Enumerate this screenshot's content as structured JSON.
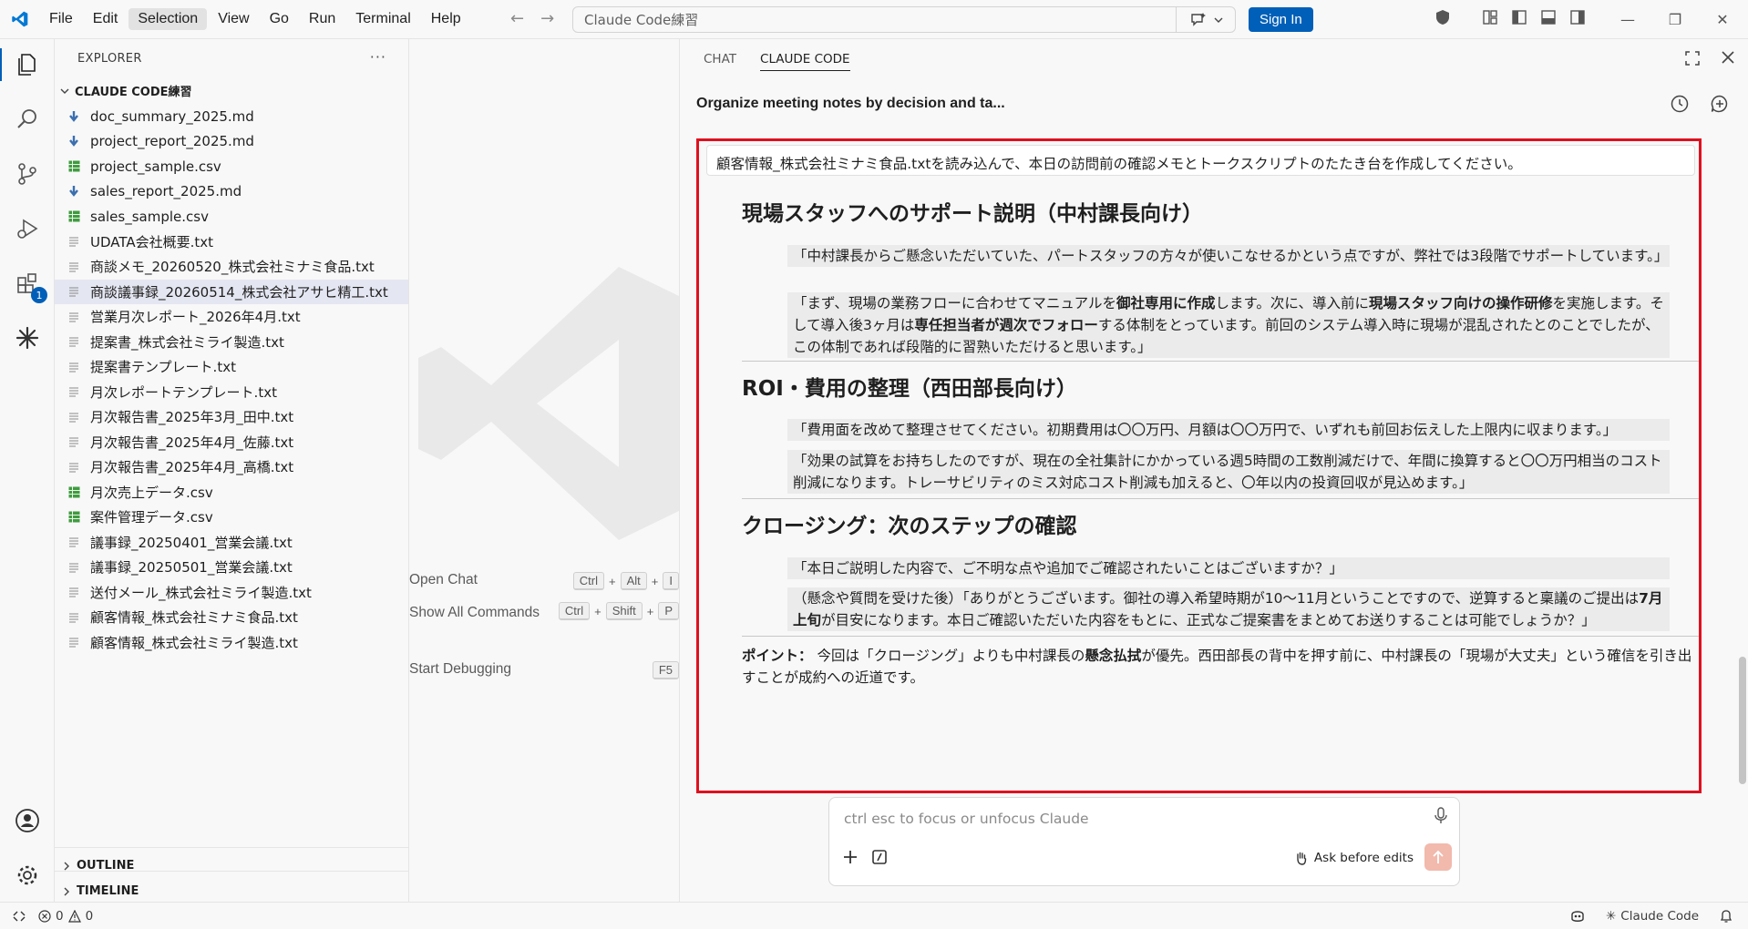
{
  "menu": [
    "File",
    "Edit",
    "Selection",
    "View",
    "Go",
    "Run",
    "Terminal",
    "Help"
  ],
  "search": {
    "text": "Claude Code練習"
  },
  "signin_label": "Sign In",
  "explorer": {
    "title": "EXPLORER",
    "folder": "CLAUDE CODE練習",
    "files": [
      {
        "name": "doc_summary_2025.md",
        "type": "md"
      },
      {
        "name": "project_report_2025.md",
        "type": "md"
      },
      {
        "name": "project_sample.csv",
        "type": "csv"
      },
      {
        "name": "sales_report_2025.md",
        "type": "md"
      },
      {
        "name": "sales_sample.csv",
        "type": "csv"
      },
      {
        "name": "UDATA会社概要.txt",
        "type": "txt"
      },
      {
        "name": "商談メモ_20260520_株式会社ミナミ食品.txt",
        "type": "txt"
      },
      {
        "name": "商談議事録_20260514_株式会社アサヒ精工.txt",
        "type": "txt"
      },
      {
        "name": "営業月次レポート_2026年4月.txt",
        "type": "txt"
      },
      {
        "name": "提案書_株式会社ミライ製造.txt",
        "type": "txt"
      },
      {
        "name": "提案書テンプレート.txt",
        "type": "txt"
      },
      {
        "name": "月次レポートテンプレート.txt",
        "type": "txt"
      },
      {
        "name": "月次報告書_2025年3月_田中.txt",
        "type": "txt"
      },
      {
        "name": "月次報告書_2025年4月_佐藤.txt",
        "type": "txt"
      },
      {
        "name": "月次報告書_2025年4月_高橋.txt",
        "type": "txt"
      },
      {
        "name": "月次売上データ.csv",
        "type": "csv"
      },
      {
        "name": "案件管理データ.csv",
        "type": "csv"
      },
      {
        "name": "議事録_20250401_営業会議.txt",
        "type": "txt"
      },
      {
        "name": "議事録_20250501_営業会議.txt",
        "type": "txt"
      },
      {
        "name": "送付メール_株式会社ミライ製造.txt",
        "type": "txt"
      },
      {
        "name": "顧客情報_株式会社ミナミ食品.txt",
        "type": "txt"
      },
      {
        "name": "顧客情報_株式会社ミライ製造.txt",
        "type": "txt"
      }
    ],
    "outline": "OUTLINE",
    "timeline": "TIMELINE"
  },
  "activity_badge": "1",
  "editor": {
    "shortcuts": [
      {
        "label": "Open Chat",
        "keys": [
          "Ctrl",
          "Alt",
          "I"
        ]
      },
      {
        "label": "Show All Commands",
        "keys": [
          "Ctrl",
          "Shift",
          "P"
        ]
      },
      {
        "label": "Start Debugging",
        "keys": [
          "F5"
        ]
      }
    ]
  },
  "panel": {
    "tabs": [
      "CHAT",
      "CLAUDE CODE"
    ],
    "session_title": "Organize meeting notes by decision and ta...",
    "user_message": "顧客情報_株式会社ミナミ食品.txtを読み込んで、本日の訪問前の確認メモとトークスクリプトのたたき台を作成してください。",
    "sections": [
      {
        "heading": "現場スタッフへのサポート説明（中村課長向け）"
      },
      {
        "heading": "ROI・費用の整理（西田部長向け）"
      },
      {
        "heading": "クロージング：次のステップの確認"
      }
    ],
    "quotes": {
      "s1q1": "「中村課長からご懸念いただいていた、パートスタッフの方々が使いこなせるかという点ですが、弊社では3段階でサポートしています。」",
      "s1q2a": "「まず、現場の業務フローに合わせてマニュアルを",
      "s1q2b": "御社専用に作成",
      "s1q2c": "します。次に、導入前に",
      "s1q2d": "現場スタッフ向けの操作研修",
      "s1q2e": "を実施します。そして導入後3ヶ月は",
      "s1q2f": "専任担当者が週次でフォロー",
      "s1q2g": "する体制をとっています。前回のシステム導入時に現場が混乱されたとのことでしたが、この体制であれば段階的に習熟いただけると思います。」",
      "s2q1": "「費用面を改めて整理させてください。初期費用は〇〇万円、月額は〇〇万円で、いずれも前回お伝えした上限内に収まります。」",
      "s2q2": "「効果の試算をお持ちしたのですが、現在の全社集計にかかっている週5時間の工数削減だけで、年間に換算すると〇〇万円相当のコスト削減になります。トレーサビリティのミス対応コスト削減も加えると、〇年以内の投資回収が見込めます。」",
      "s3q1": "「本日ご説明した内容で、ご不明な点や追加でご確認されたいことはございますか？」",
      "s3q2a": "（懸念や質問を受けた後）「ありがとうございます。御社の導入希望時期が10〜11月ということですので、逆算すると稟議のご提出は",
      "s3q2b": "7月上旬",
      "s3q2c": "が目安になります。本日ご確認いただいた内容をもとに、正式なご提案書をまとめてお送りすることは可能でしょうか？」"
    },
    "point": {
      "label": "ポイント：",
      "text1": " 今回は「クロージング」よりも中村課長の",
      "bold": "懸念払拭",
      "text2": "が優先。西田部長の背中を押す前に、中村課長の「現場が大丈夫」という確信を引き出すことが成約への近道です。"
    },
    "input_placeholder": "ctrl esc to focus or unfocus Claude",
    "ask_before_edits": "Ask before edits"
  },
  "status": {
    "errors": "0",
    "warnings": "0",
    "claude_code": "Claude Code"
  }
}
